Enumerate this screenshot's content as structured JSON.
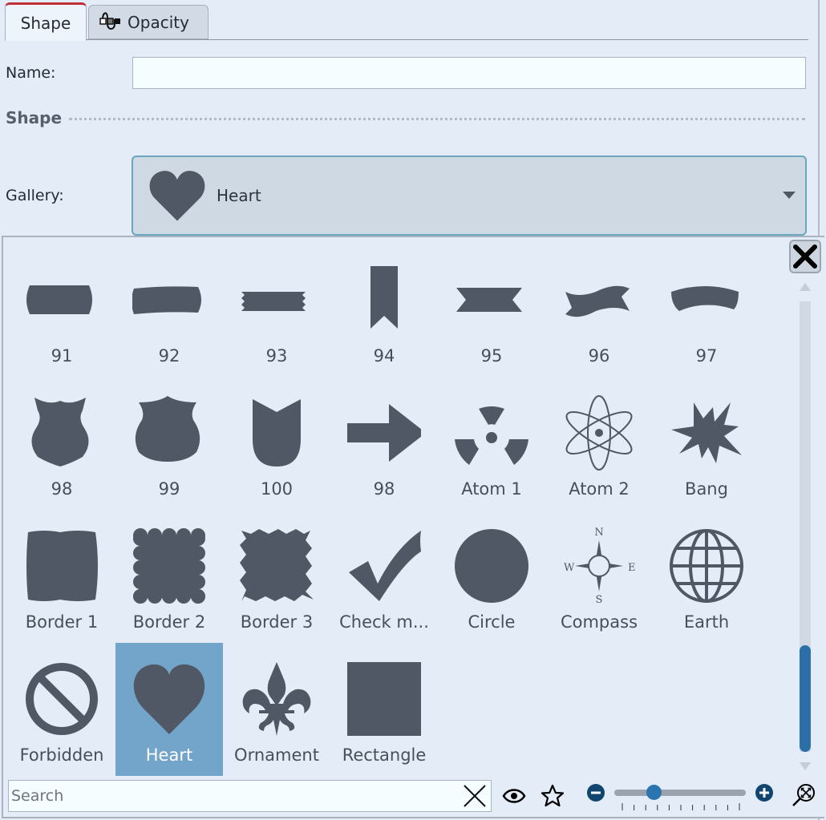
{
  "tabs": [
    {
      "label": "Shape",
      "active": true
    },
    {
      "label": "Opacity",
      "active": false,
      "icon": "opacity-keyframe-icon"
    }
  ],
  "form": {
    "name_label": "Name:",
    "name_value": "",
    "section_title": "Shape",
    "gallery_label": "Gallery:",
    "gallery_selected": "Heart",
    "gallery_selected_icon": "heart-shape-icon"
  },
  "gallery": {
    "items": [
      {
        "label": "91",
        "icon": "banner-rounded"
      },
      {
        "label": "92",
        "icon": "banner-concave"
      },
      {
        "label": "93",
        "icon": "banner-zigzag"
      },
      {
        "label": "94",
        "icon": "bookmark"
      },
      {
        "label": "95",
        "icon": "ribbon-notched"
      },
      {
        "label": "96",
        "icon": "ribbon-wavy"
      },
      {
        "label": "97",
        "icon": "banner-arched"
      },
      {
        "label": "98",
        "icon": "shield-1"
      },
      {
        "label": "99",
        "icon": "shield-2"
      },
      {
        "label": "100",
        "icon": "shield-3"
      },
      {
        "label": "98",
        "icon": "arrow-right"
      },
      {
        "label": "Atom 1",
        "icon": "radiation"
      },
      {
        "label": "Atom 2",
        "icon": "atom"
      },
      {
        "label": "Bang",
        "icon": "bang"
      },
      {
        "label": "Border 1",
        "icon": "border-wavy"
      },
      {
        "label": "Border 2",
        "icon": "border-scalloped"
      },
      {
        "label": "Border 3",
        "icon": "border-jagged"
      },
      {
        "label": "Check m...",
        "icon": "checkmark"
      },
      {
        "label": "Circle",
        "icon": "circle"
      },
      {
        "label": "Compass",
        "icon": "compass"
      },
      {
        "label": "Earth",
        "icon": "globe"
      },
      {
        "label": "Forbidden",
        "icon": "forbidden"
      },
      {
        "label": "Heart",
        "icon": "heart",
        "selected": true
      },
      {
        "label": "Ornament",
        "icon": "fleur-de-lis"
      },
      {
        "label": "Rectangle",
        "icon": "rectangle"
      }
    ],
    "compass_letters": {
      "n": "N",
      "s": "S",
      "e": "E",
      "w": "W"
    },
    "scroll_position": 0.88
  },
  "footer": {
    "search_placeholder": "Search",
    "search_value": "",
    "zoom_level": 0.25,
    "zoom_tick_count": 11
  },
  "colors": {
    "shape_fill": "#4f5864",
    "selected_bg": "#73a4ca",
    "accent": "#2a75b0",
    "active_tab_indicator": "#c0303a"
  }
}
